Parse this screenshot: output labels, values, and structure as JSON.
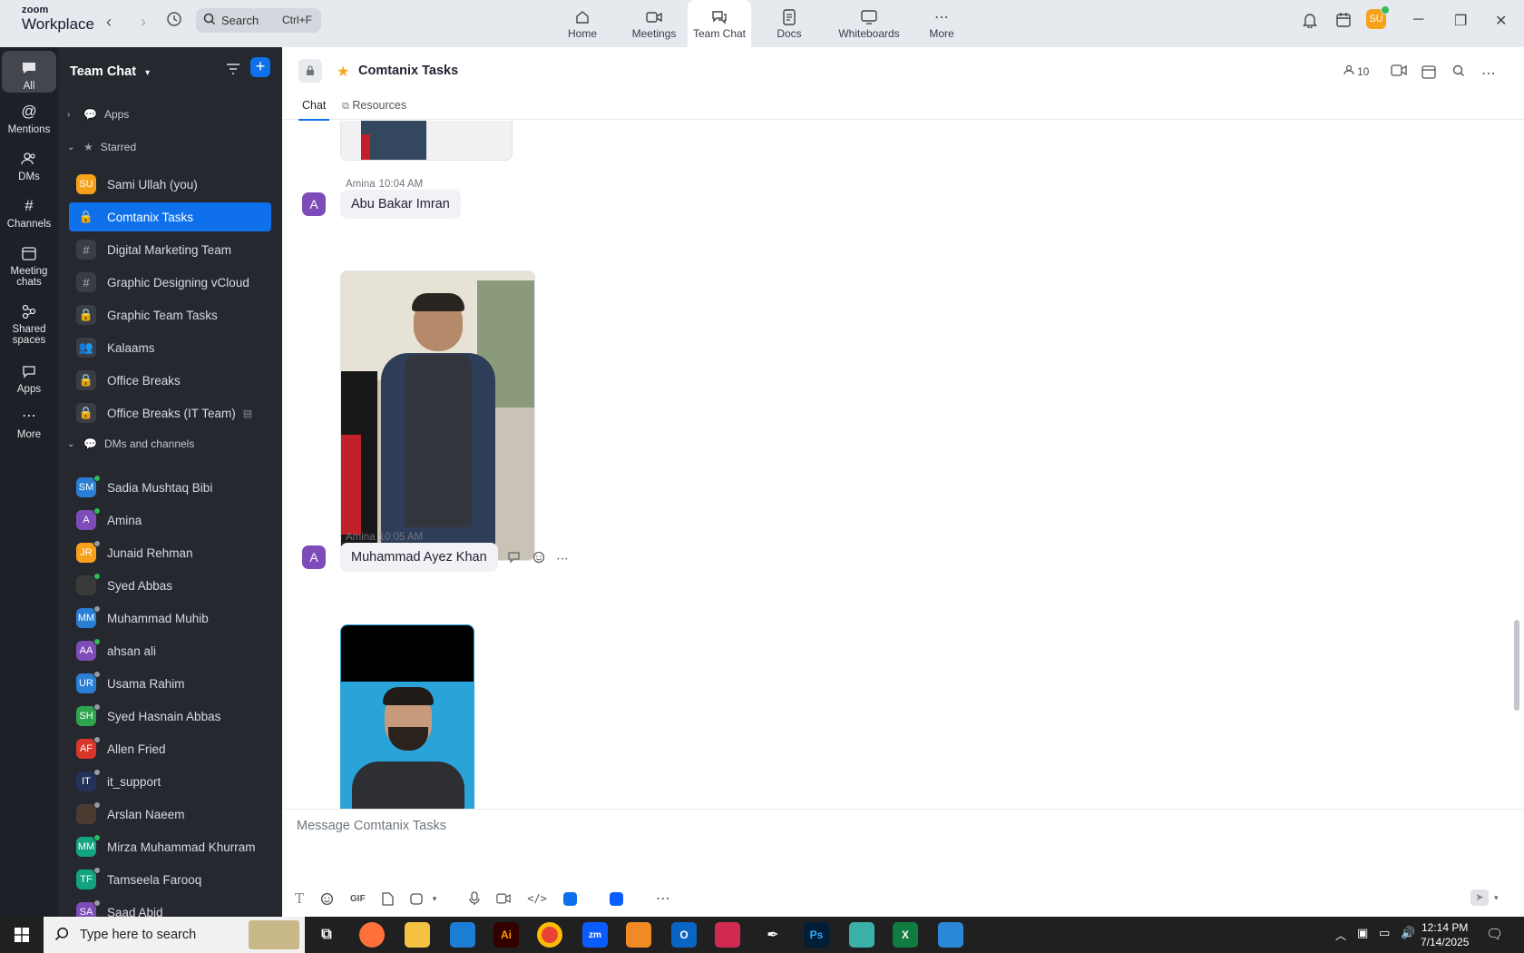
{
  "app": {
    "brand_top": "zoom",
    "brand_bottom": "Workplace",
    "search_placeholder": "Search",
    "search_shortcut": "Ctrl+F",
    "nav_tabs": [
      {
        "label": "Home",
        "icon": "home-icon"
      },
      {
        "label": "Meetings",
        "icon": "video-camera-icon"
      },
      {
        "label": "Team Chat",
        "icon": "chat-bubbles-icon"
      },
      {
        "label": "Docs",
        "icon": "doc-icon"
      },
      {
        "label": "Whiteboards",
        "icon": "whiteboard-icon"
      },
      {
        "label": "More",
        "icon": "ellipsis-icon"
      }
    ],
    "active_tab": "Team Chat",
    "user_initials": "SU",
    "accent": "#0e71eb"
  },
  "rail": [
    {
      "label": "All",
      "icon": "chat-icon"
    },
    {
      "label": "Mentions",
      "icon": "at-icon"
    },
    {
      "label": "DMs",
      "icon": "people-icon"
    },
    {
      "label": "Channels",
      "icon": "hash-icon"
    },
    {
      "label": "Meeting chats",
      "icon": "calendar-icon"
    },
    {
      "label": "Shared spaces",
      "icon": "share-icon"
    },
    {
      "label": "Apps",
      "icon": "chat-apps-icon"
    },
    {
      "label": "More",
      "icon": "more-dots-icon"
    }
  ],
  "sidebar": {
    "title": "Team Chat",
    "apps_label": "Apps",
    "starred_label": "Starred",
    "dms_label": "DMs and channels",
    "starred": [
      {
        "label": "Sami Ullah (you)",
        "kind": "avatar",
        "initials": "SU",
        "color": "#f7a11a",
        "status": "#2dbd54"
      },
      {
        "label": "Comtanix Tasks",
        "kind": "lock",
        "active": true
      },
      {
        "label": "Digital Marketing Team",
        "kind": "hash"
      },
      {
        "label": "Graphic Designing vCloud",
        "kind": "hash"
      },
      {
        "label": "Graphic Team Tasks",
        "kind": "lock"
      },
      {
        "label": "Kalaams",
        "kind": "group"
      },
      {
        "label": "Office Breaks",
        "kind": "lock"
      },
      {
        "label": "Office Breaks (IT Team)",
        "kind": "lock"
      }
    ],
    "dms": [
      {
        "label": "Sadia Mushtaq Bibi",
        "initials": "SM",
        "color": "#2a7fd4",
        "status": "#2dbd54"
      },
      {
        "label": "Amina",
        "initials": "A",
        "color": "#7e4cb8",
        "status": "#2dbd54"
      },
      {
        "label": "Junaid Rehman",
        "initials": "JR",
        "color": "#f7a11a",
        "status": "#9a9aa2"
      },
      {
        "label": "Syed Abbas",
        "initials": "",
        "color": "#3a3a3a",
        "status": "#2dbd54"
      },
      {
        "label": "Muhammad Muhib",
        "initials": "MM",
        "color": "#2a7fd4",
        "status": "#9a9aa2"
      },
      {
        "label": "ahsan ali",
        "initials": "AA",
        "color": "#7e4cb8",
        "status": "#2dbd54"
      },
      {
        "label": "Usama Rahim",
        "initials": "UR",
        "color": "#2a7fd4",
        "status": "#9a9aa2"
      },
      {
        "label": "Syed Hasnain Abbas",
        "initials": "SH",
        "color": "#2da44e",
        "status": "#9a9aa2"
      },
      {
        "label": "Allen Fried",
        "initials": "AF",
        "color": "#d9362b",
        "status": "#9a9aa2"
      },
      {
        "label": "it_support",
        "initials": "IT",
        "color": "#23325a",
        "status": "#9a9aa2"
      },
      {
        "label": "Arslan Naeem",
        "initials": "",
        "color": "#4a3a30",
        "status": "#9a9aa2"
      },
      {
        "label": "Mirza Muhammad Khurram",
        "initials": "MM",
        "color": "#12a37f",
        "status": "#2dbd54"
      },
      {
        "label": "Tamseela Farooq",
        "initials": "TF",
        "color": "#12a37f",
        "status": "#9a9aa2"
      },
      {
        "label": "Saad Abid",
        "initials": "SA",
        "color": "#7e4cb8",
        "status": "#9a9aa2"
      }
    ]
  },
  "channel": {
    "name": "Comtanix Tasks",
    "member_count": "10",
    "tabs": [
      "Chat",
      "Resources"
    ]
  },
  "messages": [
    {
      "sender": "Amina",
      "time": "10:04 AM",
      "avatar": "A",
      "text": "Abu Bakar Imran"
    },
    {
      "sender": "Amina",
      "time": "10:05 AM",
      "avatar": "A",
      "text": "Muhammad Ayez Khan"
    }
  ],
  "composer": {
    "placeholder": "Message Comtanix Tasks",
    "gif_label": "GIF"
  },
  "taskbar": {
    "search_placeholder": "Type here to search",
    "time": "12:14 PM",
    "date": "7/14/2025"
  }
}
